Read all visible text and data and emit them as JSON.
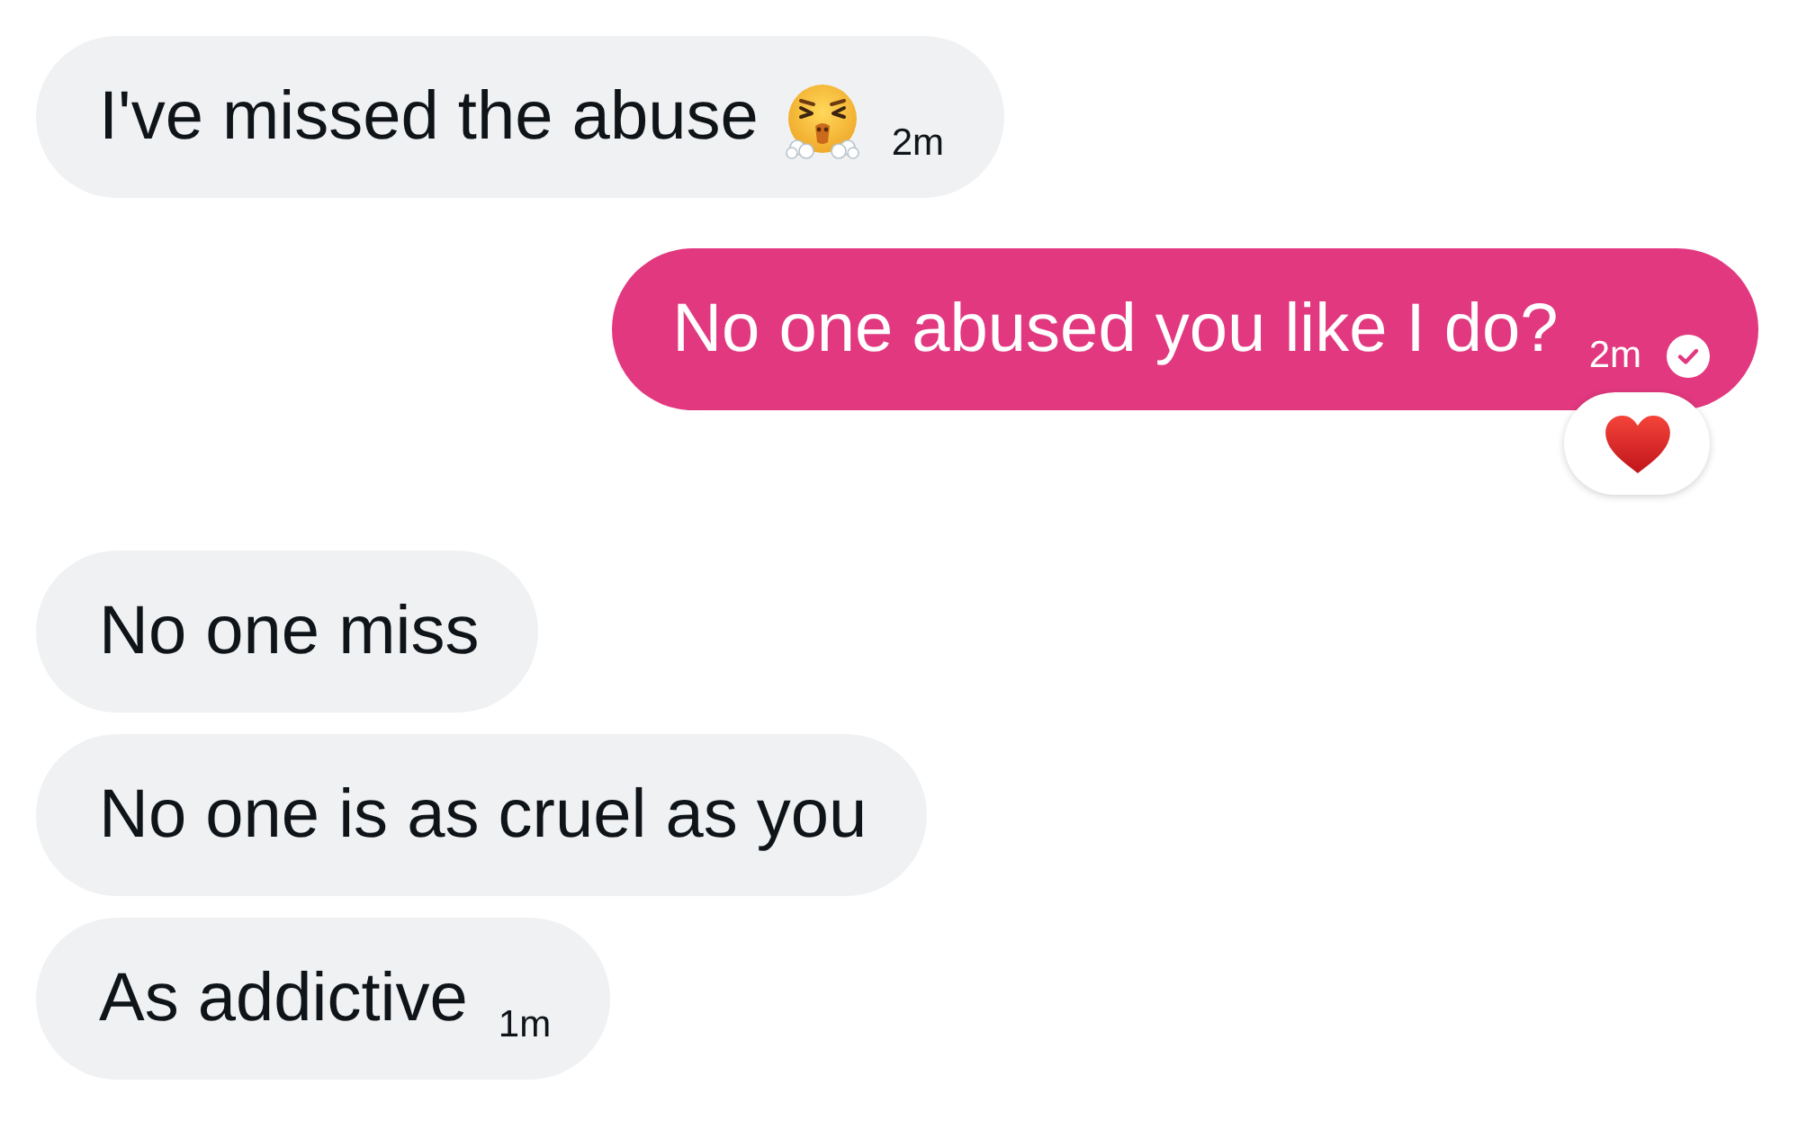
{
  "messages": [
    {
      "kind": "received",
      "text": "I've missed the abuse",
      "trailing_emoji": true,
      "time": "2m"
    },
    {
      "kind": "sent",
      "text": "No one abused you like I do?",
      "time": "2m",
      "read": true,
      "reacted": true
    },
    {
      "kind": "received",
      "text": "No one miss"
    },
    {
      "kind": "received",
      "text": "No one is as cruel as you"
    },
    {
      "kind": "received",
      "text": "As addictive",
      "time": "1m"
    }
  ]
}
